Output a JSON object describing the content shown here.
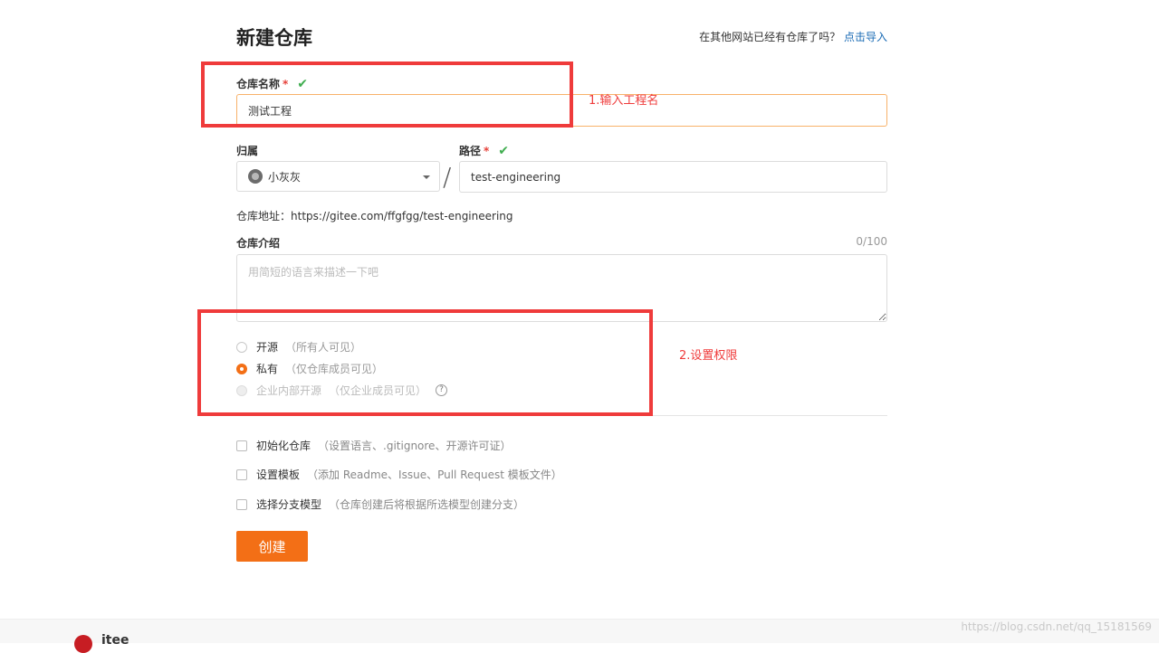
{
  "page": {
    "title": "新建仓库"
  },
  "import": {
    "question": "在其他网站已经有仓库了吗？",
    "link": "点击导入"
  },
  "repo_name": {
    "label": "仓库名称",
    "required": "*",
    "check": "✔",
    "value": "测试工程"
  },
  "owner": {
    "label": "归属",
    "value": "小灰灰"
  },
  "path": {
    "label": "路径",
    "required": "*",
    "check": "✔",
    "value": "test-engineering",
    "separator": "/"
  },
  "repo_url": {
    "label": "仓库地址：",
    "value": "https://gitee.com/ffgfgg/test-engineering"
  },
  "description": {
    "label": "仓库介绍",
    "counter": "0/100",
    "placeholder": "用简短的语言来描述一下吧"
  },
  "visibility": [
    {
      "label": "开源",
      "hint": "（所有人可见）",
      "selected": false,
      "disabled": false
    },
    {
      "label": "私有",
      "hint": "（仅仓库成员可见）",
      "selected": true,
      "disabled": false
    },
    {
      "label": "企业内部开源",
      "hint": "（仅企业成员可见）",
      "selected": false,
      "disabled": true
    }
  ],
  "help_icon": "?",
  "options": [
    {
      "label": "初始化仓库",
      "hint": "（设置语言、.gitignore、开源许可证）"
    },
    {
      "label": "设置模板",
      "hint": "（添加 Readme、Issue、Pull Request 模板文件）"
    },
    {
      "label": "选择分支模型",
      "hint": "（仓库创建后将根据所选模型创建分支）"
    }
  ],
  "create_button": "创建",
  "annotations": {
    "step1": "1.输入工程名",
    "step2": "2.设置权限"
  },
  "footer": {
    "logo_text": "itee"
  },
  "watermark": "https://blog.csdn.net/qq_15181569",
  "colors": {
    "accent": "#f36f16",
    "annotation": "#ef3b3b",
    "link": "#1a6bb5",
    "check": "#3fad4f"
  }
}
